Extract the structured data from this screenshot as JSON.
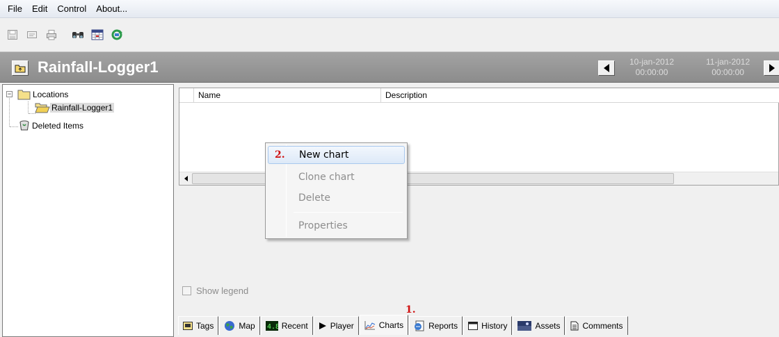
{
  "menu": [
    "File",
    "Edit",
    "Control",
    "About..."
  ],
  "toolbar": {
    "icons": [
      "save-icon",
      "properties-icon",
      "print-icon",
      "find-icon",
      "calendar-icon",
      "refresh-icon"
    ]
  },
  "header": {
    "title": "Rainfall-Logger1",
    "date_from": "10-jan-2012",
    "time_from": "00:00:00",
    "date_to": "11-jan-2012",
    "time_to": "00:00:00"
  },
  "tree": {
    "root": "Locations",
    "child": "Rainfall-Logger1",
    "deleted": "Deleted Items"
  },
  "list": {
    "columns": [
      "Name",
      "Description"
    ]
  },
  "context_menu": {
    "step_label": "2.",
    "items": [
      {
        "label": "New chart",
        "enabled": true
      },
      {
        "label": "Clone chart",
        "enabled": false
      },
      {
        "label": "Delete",
        "enabled": false
      },
      {
        "label": "Properties",
        "enabled": false
      }
    ]
  },
  "legend_label": "Show legend",
  "tabs": {
    "step_label": "1.",
    "items": [
      "Tags",
      "Map",
      "Recent",
      "Player",
      "Charts",
      "Reports",
      "History",
      "Assets",
      "Comments"
    ],
    "active": "Charts"
  },
  "colors": {
    "title_bar": "#999999",
    "step_marker": "#d01010",
    "menu_highlight": "#dde9f8"
  }
}
